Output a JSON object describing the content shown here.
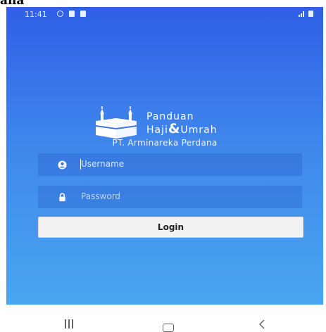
{
  "top_clip_text": "ana",
  "status_bar": {
    "time": "11:41"
  },
  "app": {
    "brand_line1": "Panduan",
    "brand_line2_a": "Haji",
    "brand_line2_amp": "&",
    "brand_line2_b": "Umrah",
    "company": "PT. Arminareka Perdana"
  },
  "form": {
    "username_placeholder": "Username",
    "password_placeholder": "Password",
    "login_label": "Login"
  },
  "colors": {
    "gradient_top": "#2f5fe6",
    "gradient_bottom": "#4aa6f0",
    "button_bg": "#f2f2f2"
  }
}
